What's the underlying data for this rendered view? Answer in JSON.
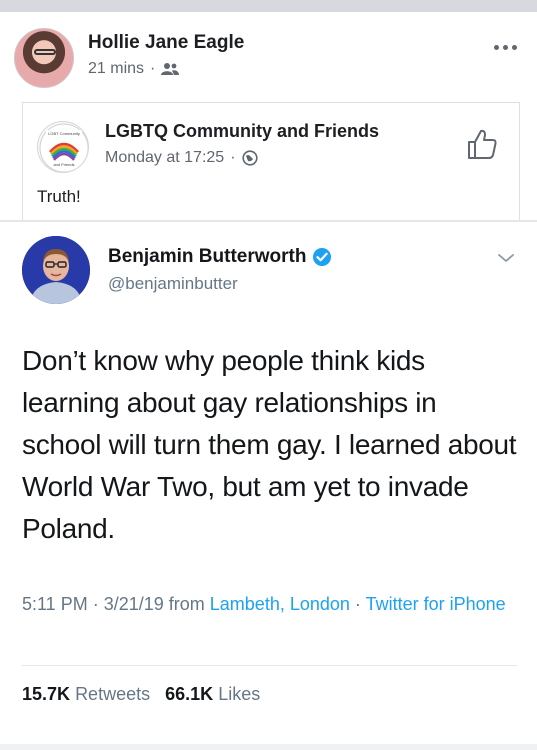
{
  "post": {
    "author": "Hollie Jane Eagle",
    "time": "21 mins",
    "separator": "·",
    "audience_icon": "friends-icon"
  },
  "shared": {
    "group_name": "LGBTQ Community and Friends",
    "time": "Monday at 17:25",
    "separator": "·",
    "privacy_icon": "globe-icon",
    "text": "Truth!",
    "group_avatar_text_top": "LGBT Community",
    "group_avatar_text_bottom": "and Friends"
  },
  "tweet": {
    "name": "Benjamin Butterworth",
    "handle": "@benjaminbutter",
    "body": "Don’t know why people think kids learning about gay relationships in school will turn them gay. I learned about World War Two, but am yet to invade Poland.",
    "time_date": "5:11 PM · 3/21/19",
    "from_word": "from",
    "location": "Lambeth, London",
    "sep": "·",
    "source": "Twitter for iPhone",
    "retweets_count": "15.7K",
    "retweets_label": "Retweets",
    "likes_count": "66.1K",
    "likes_label": "Likes"
  },
  "colors": {
    "twitter_blue": "#1da1f2",
    "fb_text": "#1c1e21",
    "meta_gray": "#606770"
  }
}
